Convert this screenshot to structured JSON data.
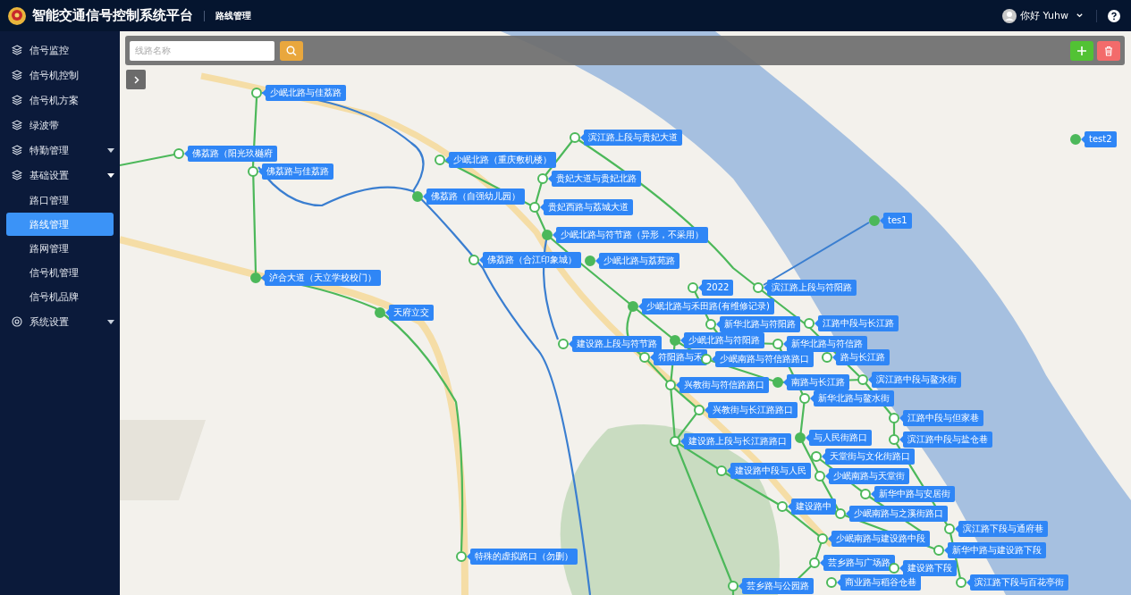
{
  "header": {
    "title": "智能交通信号控制系统平台",
    "breadcrumb": "路线管理",
    "user": "你好 Yuhw"
  },
  "sidebar": {
    "items": [
      {
        "label": "信号监控"
      },
      {
        "label": "信号机控制"
      },
      {
        "label": "信号机方案"
      },
      {
        "label": "绿波带"
      },
      {
        "label": "特勤管理",
        "expanded": false
      },
      {
        "label": "基础设置",
        "expanded": true,
        "children": [
          {
            "label": "路口管理",
            "selected": false
          },
          {
            "label": "路线管理",
            "selected": true
          },
          {
            "label": "路网管理",
            "selected": false
          },
          {
            "label": "信号机管理",
            "selected": false
          },
          {
            "label": "信号机品牌",
            "selected": false
          }
        ]
      },
      {
        "label": "系统设置",
        "expanded": false
      }
    ]
  },
  "toolbar": {
    "search": {
      "placeholder": "线路名称"
    }
  },
  "map": {
    "markers": [
      {
        "label": "少岷北路与佳荔路",
        "filled": false
      },
      {
        "label": "佛荔路（阳光玖樾府",
        "filled": false
      },
      {
        "label": "佛荔路与佳荔路",
        "filled": false
      },
      {
        "label": "泸合大道（天立学校校门）",
        "filled": true
      },
      {
        "label": "天府立交",
        "filled": true
      },
      {
        "label": "少岷北路（重庆敷机楼）",
        "filled": false
      },
      {
        "label": "佛荔路（自强幼儿园）",
        "filled": true
      },
      {
        "label": "贵妃西路与荔城大道",
        "filled": false
      },
      {
        "label": "滨江路上段与贵妃大道",
        "filled": false
      },
      {
        "label": "贵妃大道与贵妃北路",
        "filled": false
      },
      {
        "label": "少岷北路与符节路（异形，不采用）",
        "filled": true
      },
      {
        "label": "佛荔路（合江印象城）",
        "filled": false
      },
      {
        "label": "少岷北路与荔苑路",
        "filled": true
      },
      {
        "label": "2022",
        "filled": false
      },
      {
        "label": "滨江路上段与符阳路",
        "filled": false
      },
      {
        "label": "少岷北路与禾田路(有维修记录)",
        "filled": true
      },
      {
        "label": "新华北路与符阳路",
        "filled": false
      },
      {
        "label": "新华北路与符信路",
        "filled": false
      },
      {
        "label": "江路中段与长江路",
        "filled": false
      },
      {
        "label": "建设路上段与符节路",
        "filled": false
      },
      {
        "label": "少岷北路与符阳路",
        "filled": true
      },
      {
        "label": "符阳路与禾",
        "filled": false
      },
      {
        "label": "少岷南路与符信路路口",
        "filled": false
      },
      {
        "label": "路与长江路",
        "filled": false
      },
      {
        "label": "兴教街与符信路路口",
        "filled": false
      },
      {
        "label": "南路与长江路",
        "filled": true
      },
      {
        "label": "滨江路中段与鳌水街",
        "filled": false
      },
      {
        "label": "新华北路与鳌水街",
        "filled": false
      },
      {
        "label": "兴教街与长江路路口",
        "filled": false
      },
      {
        "label": "江路中段与但家巷",
        "filled": false
      },
      {
        "label": "建设路上段与长江路路口",
        "filled": false
      },
      {
        "label": "与人民街路口",
        "filled": true
      },
      {
        "label": "滨江路中段与盐仓巷",
        "filled": false
      },
      {
        "label": "天堂街与文化街路口",
        "filled": false
      },
      {
        "label": "建设路中段与人民",
        "filled": false
      },
      {
        "label": "少岷南路与天堂街",
        "filled": false
      },
      {
        "label": "新华中路与安居街",
        "filled": false
      },
      {
        "label": "建设路中",
        "filled": false
      },
      {
        "label": "少岷南路与之溪街路口",
        "filled": false
      },
      {
        "label": "滨江路下段与通府巷",
        "filled": false
      },
      {
        "label": "少岷南路与建设路中段",
        "filled": false
      },
      {
        "label": "新华中路与建设路下段",
        "filled": false
      },
      {
        "label": "芸乡路与广场路",
        "filled": false
      },
      {
        "label": "建设路下段",
        "filled": false
      },
      {
        "label": "芸乡路与公园路",
        "filled": false
      },
      {
        "label": "商业路与稻谷仓巷",
        "filled": false
      },
      {
        "label": "滨江路下段与百花亭街",
        "filled": false
      },
      {
        "label": "特殊的虚拟路口（勿删）",
        "filled": false
      },
      {
        "label": "tes1",
        "filled": true
      },
      {
        "label": "test2",
        "filled": true
      }
    ]
  }
}
